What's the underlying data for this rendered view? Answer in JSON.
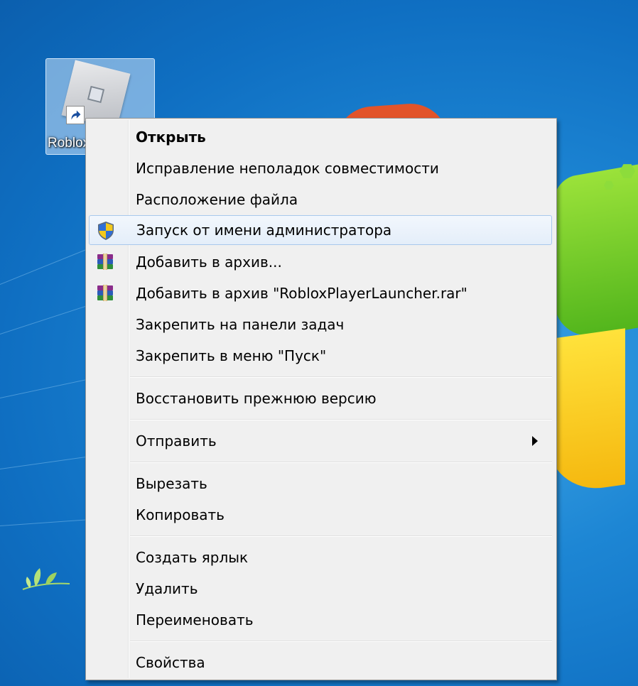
{
  "desktop": {
    "icon_label": "Roblox",
    "icon_name": "roblox-icon",
    "shortcut_overlay_icon": "shortcut-arrow-icon"
  },
  "context_menu": {
    "items": [
      {
        "label": "Открыть",
        "bold": true
      },
      {
        "label": "Исправление неполадок совместимости"
      },
      {
        "label": "Расположение файла"
      },
      {
        "label": "Запуск от имени администратора",
        "icon": "uac-shield-icon",
        "highlighted": true
      },
      {
        "label": "Добавить в архив...",
        "icon": "winrar-icon"
      },
      {
        "label": "Добавить в архив \"RobloxPlayerLauncher.rar\"",
        "icon": "winrar-icon"
      },
      {
        "label": "Закрепить на панели задач"
      },
      {
        "label": "Закрепить в меню \"Пуск\""
      },
      {
        "label": "Восстановить прежнюю версию"
      },
      {
        "label": "Отправить",
        "submenu": true
      },
      {
        "label": "Вырезать"
      },
      {
        "label": "Копировать"
      },
      {
        "label": "Создать ярлык"
      },
      {
        "label": "Удалить"
      },
      {
        "label": "Переименовать"
      },
      {
        "label": "Свойства"
      }
    ]
  },
  "colors": {
    "menu_background": "#f0f0f0",
    "highlight_border": "#a8c8ec",
    "desktop_blue": "#1d86d4"
  }
}
